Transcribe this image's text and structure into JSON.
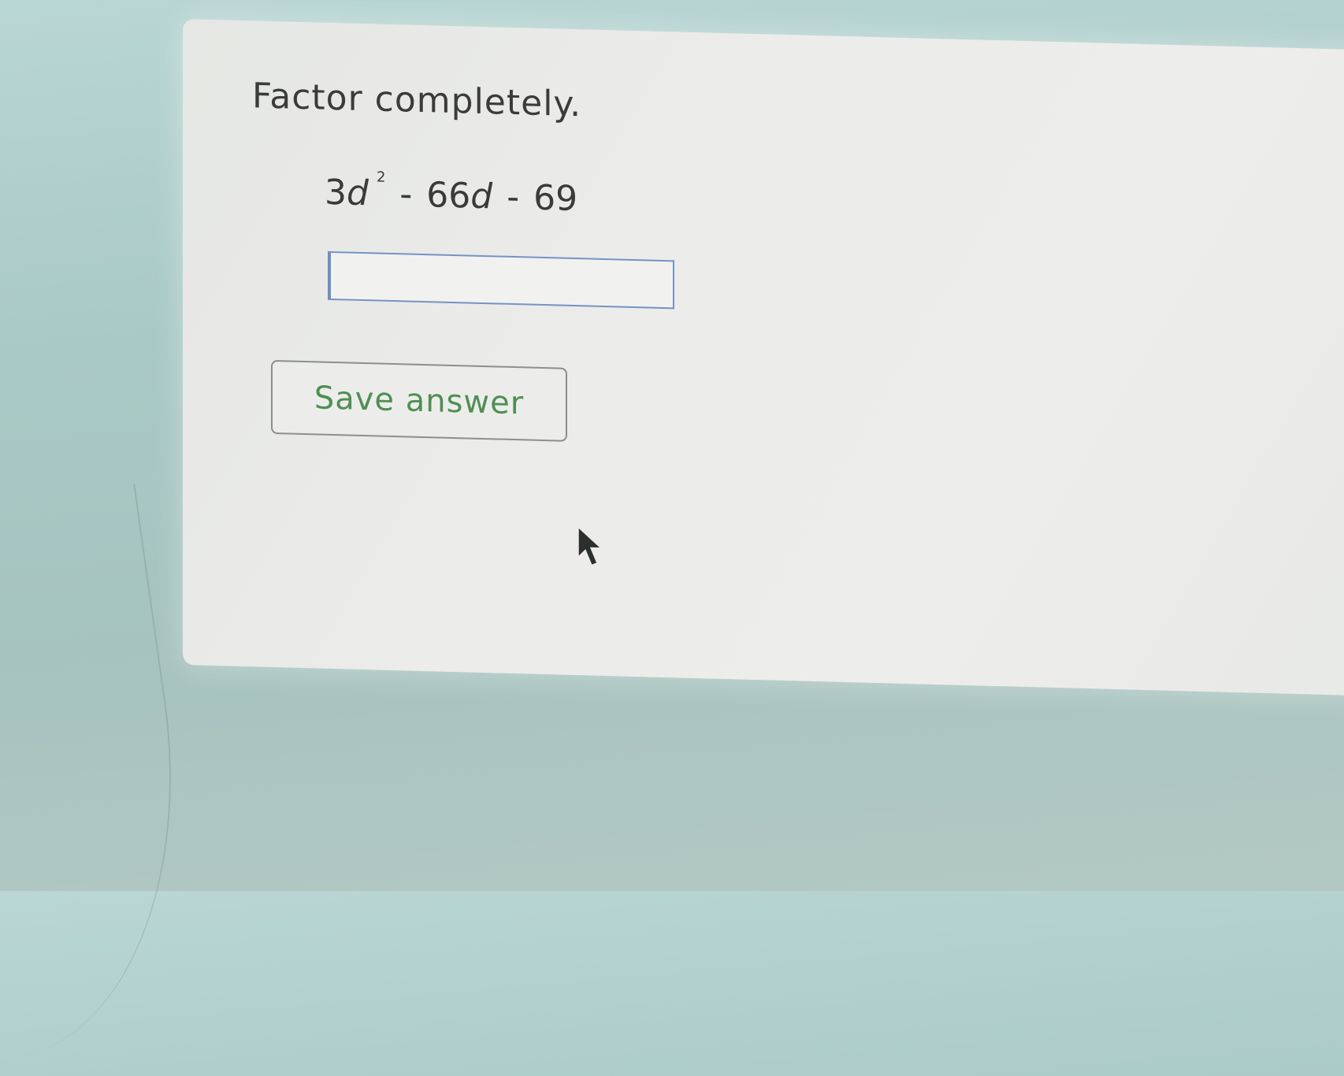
{
  "question": {
    "prompt": "Factor completely.",
    "expression": {
      "coef1": "3",
      "var1": "d",
      "exponent": "2",
      "op1": "-",
      "coef2": "66",
      "var2": "d",
      "op2": "-",
      "constant": "69"
    }
  },
  "answer": {
    "value": "",
    "placeholder": ""
  },
  "actions": {
    "save_label": "Save answer"
  },
  "icons": {
    "cursor": "mouse-pointer-icon"
  },
  "colors": {
    "button_text": "#4f8f53",
    "input_border": "#7394c2"
  }
}
